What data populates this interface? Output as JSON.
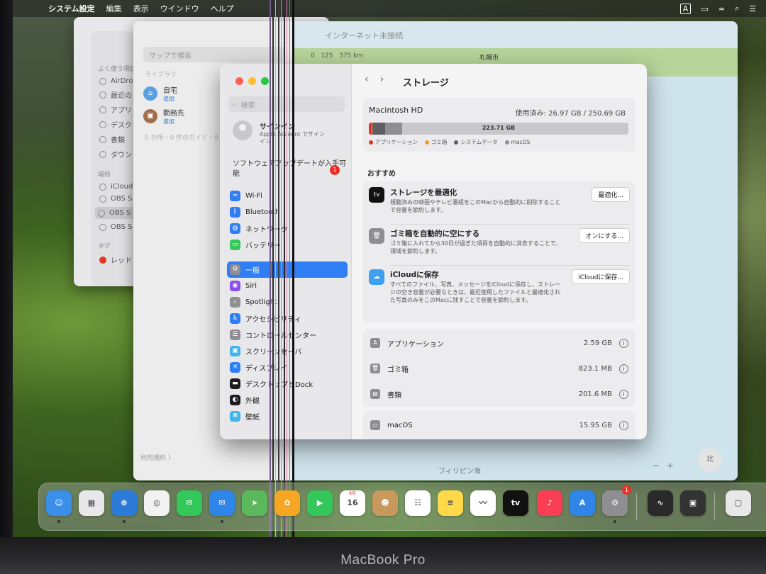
{
  "menubar": {
    "apple_icon": "apple-icon",
    "items": [
      "システム設定",
      "編集",
      "表示",
      "ウインドウ",
      "ヘルプ"
    ],
    "input_indicator": "A"
  },
  "finder": {
    "sections": {
      "favorites": "よく使う項目",
      "locations": "場所",
      "tags": "タグ"
    },
    "favorites": [
      "AirDro",
      "最近の",
      "アプリ",
      "デスク",
      "書類",
      "ダウン"
    ],
    "locations": [
      "iCloud",
      "OBS S",
      "OBS S",
      "OBS S"
    ],
    "tags": [
      "レッド"
    ]
  },
  "maps": {
    "title": "インターネット未接続",
    "search_placeholder": "マップで検索",
    "library_label": "ライブラリ",
    "places": [
      {
        "name": "自宅",
        "action": "追加"
      },
      {
        "name": "勤務先",
        "action": "追加"
      }
    ],
    "guide_summary": "0 か所・0 件のガイド・0",
    "footer": "利用規約 〉",
    "scale_left": "0",
    "scale_mid": "125",
    "scale_km": "375 km",
    "city": "札幌市",
    "region": "フィリピン海",
    "zoom_minus": "−",
    "zoom_plus": "+",
    "compass": "北"
  },
  "settings": {
    "search_placeholder": "検索",
    "account_title": "サインイン",
    "account_sub": "Apple Account でサインイン",
    "update_text": "ソフトウェアアップデートが入手可能",
    "update_badge": "1",
    "sidebar_items": [
      {
        "label": "Wi-Fi",
        "icon": "wifi-icon",
        "color": "#2f7ef5",
        "glyph": "≈"
      },
      {
        "label": "Bluetooth",
        "icon": "bluetooth-icon",
        "color": "#2f7ef5",
        "glyph": "ᛒ"
      },
      {
        "label": "ネットワーク",
        "icon": "network-icon",
        "color": "#2f7ef5",
        "glyph": "◍"
      },
      {
        "label": "バッテリー",
        "icon": "battery-icon",
        "color": "#34c759",
        "glyph": "▭"
      },
      {
        "label": "一般",
        "icon": "gear-icon",
        "color": "#8e8e93",
        "glyph": "⚙",
        "selected": true,
        "gap": true
      },
      {
        "label": "Siri",
        "icon": "siri-icon",
        "color": "#8a4de8",
        "glyph": "◉"
      },
      {
        "label": "Spotlight",
        "icon": "spotlight-icon",
        "color": "#8e8e93",
        "glyph": "⌕"
      },
      {
        "label": "アクセシビリティ",
        "icon": "accessibility-icon",
        "color": "#2f7ef5",
        "glyph": "♿"
      },
      {
        "label": "コントロールセンター",
        "icon": "control-center-icon",
        "color": "#8e8e93",
        "glyph": "☰"
      },
      {
        "label": "スクリーンセーバ",
        "icon": "screensaver-icon",
        "color": "#3fb4e8",
        "glyph": "▣"
      },
      {
        "label": "ディスプレイ",
        "icon": "display-icon",
        "color": "#2f7ef5",
        "glyph": "☀"
      },
      {
        "label": "デスクトップとDock",
        "icon": "dock-icon",
        "color": "#1c1c1e",
        "glyph": "▬"
      },
      {
        "label": "外観",
        "icon": "appearance-icon",
        "color": "#1c1c1e",
        "glyph": "◐"
      },
      {
        "label": "壁紙",
        "icon": "wallpaper-icon",
        "color": "#3fb4e8",
        "glyph": "❋"
      }
    ],
    "page_title": "ストレージ",
    "disk": {
      "name": "Macintosh HD",
      "used_text": "使用済み: 26.97 GB / 250.69 GB",
      "free_text": "223.71 GB",
      "legend": [
        "アプリケーション",
        "ゴミ箱",
        "システムデータ",
        "macOS"
      ],
      "legend_colors": [
        "#e5332a",
        "#f29a2e",
        "#5f5f63",
        "#8e8e93"
      ],
      "fractions": [
        0.01,
        0.0033,
        0.05,
        0.064
      ]
    },
    "recommend_heading": "おすすめ",
    "recommendations": [
      {
        "title": "ストレージを最適化",
        "desc": "視聴済みの映画やテレビ番組をこのMacから自動的に削除することで容量を節約します。",
        "button": "最適化...",
        "icon": "apple-tv-icon",
        "glyph": "tv",
        "color": "#111111"
      },
      {
        "title": "ゴミ箱を自動的に空にする",
        "desc": "ゴミ箱に入れてから30日が過ぎた項目を自動的に消去することで、領域を節約します。",
        "button": "オンにする...",
        "icon": "trash-icon",
        "glyph": "🗑",
        "color": "#8e8e93"
      },
      {
        "title": "iCloudに保存",
        "desc": "すべてのファイル、写真、メッセージをiCloudに保存し、ストレージの空き容量が必要なときは、最近使用したファイルと最適化された写真のみをこのMacに残すことで容量を節約します。",
        "button": "iCloudに保存...",
        "icon": "icloud-icon",
        "glyph": "☁",
        "color": "#3fa0f0"
      }
    ],
    "categories": [
      {
        "name": "アプリケーション",
        "size": "2.59 GB",
        "icon": "applications-icon",
        "glyph": "A"
      },
      {
        "name": "ゴミ箱",
        "size": "823.1 MB",
        "icon": "trash-icon",
        "glyph": "🗑"
      },
      {
        "name": "書類",
        "size": "201.6 MB",
        "icon": "documents-icon",
        "glyph": "▤"
      },
      {
        "name": "macOS",
        "size": "15.95 GB",
        "icon": "macos-icon",
        "glyph": "▭"
      }
    ]
  },
  "dock": {
    "apps": [
      {
        "name": "finder",
        "color": "#3b8fe8",
        "glyph": "☺"
      },
      {
        "name": "launchpad",
        "color": "#e8e8ea",
        "glyph": "▦"
      },
      {
        "name": "safari",
        "color": "#2d7bd9",
        "glyph": "⊕"
      },
      {
        "name": "chrome",
        "color": "#f2f2f2",
        "glyph": "◎"
      },
      {
        "name": "messages",
        "color": "#34c759",
        "glyph": "✉"
      },
      {
        "name": "mail",
        "color": "#2f86e8",
        "glyph": "✉"
      },
      {
        "name": "maps",
        "color": "#5cb85c",
        "glyph": "➤"
      },
      {
        "name": "photos",
        "color": "#f5a623",
        "glyph": "✿"
      },
      {
        "name": "facetime",
        "color": "#34c759",
        "glyph": "▶"
      },
      {
        "name": "calendar",
        "color": "#ffffff",
        "glyph": "16",
        "label_top": "8月"
      },
      {
        "name": "contacts",
        "color": "#c8995d",
        "glyph": "☻"
      },
      {
        "name": "reminders",
        "color": "#ffffff",
        "glyph": "☷"
      },
      {
        "name": "notes",
        "color": "#ffd94a",
        "glyph": "≡"
      },
      {
        "name": "freeform",
        "color": "#ffffff",
        "glyph": "〰"
      },
      {
        "name": "tv",
        "color": "#111111",
        "glyph": "tv"
      },
      {
        "name": "music",
        "color": "#fa3f55",
        "glyph": "♪"
      },
      {
        "name": "app-store",
        "color": "#2f86e8",
        "glyph": "A"
      },
      {
        "name": "system-settings",
        "color": "#8e8e93",
        "glyph": "⚙",
        "badge": "1"
      },
      {
        "name": "activity-monitor",
        "color": "#2a2a2a",
        "glyph": "∿"
      },
      {
        "name": "photo-booth",
        "color": "#333333",
        "glyph": "▣"
      },
      {
        "name": "documents",
        "color": "#e8e8e8",
        "glyph": "▢"
      }
    ]
  },
  "laptop_brand": "MacBook Pro"
}
